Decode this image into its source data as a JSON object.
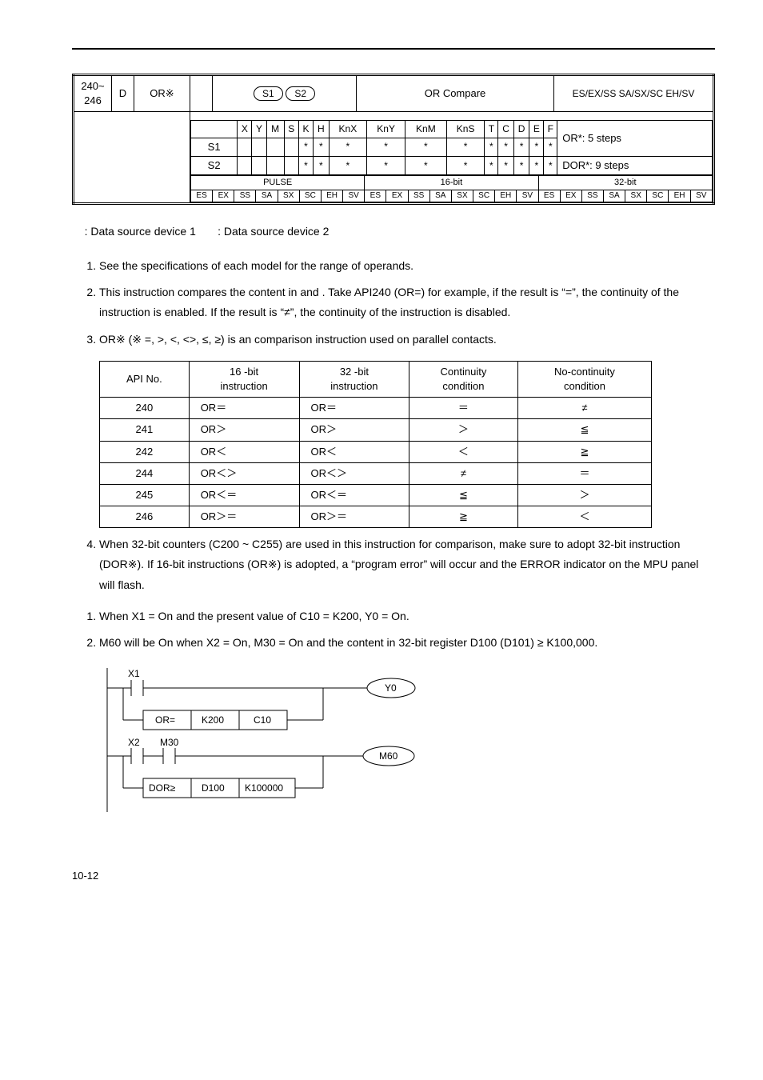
{
  "header": {
    "api_range": "240~\n246",
    "d": "D",
    "mnemonic": "OR※",
    "s1_label": "S1",
    "s2_label": "S2",
    "function": "OR Compare",
    "controllers": "ES/EX/SS SA/SX/SC EH/SV"
  },
  "opgrid": {
    "cols": [
      "X",
      "Y",
      "M",
      "S",
      "K",
      "H",
      "KnX",
      "KnY",
      "KnM",
      "KnS",
      "T",
      "C",
      "D",
      "E",
      "F"
    ],
    "rows": [
      {
        "label": "S1",
        "stars": [
          false,
          false,
          false,
          false,
          true,
          true,
          true,
          true,
          true,
          true,
          true,
          true,
          true,
          true,
          true
        ]
      },
      {
        "label": "S2",
        "stars": [
          false,
          false,
          false,
          false,
          true,
          true,
          true,
          true,
          true,
          true,
          true,
          true,
          true,
          true,
          true
        ]
      }
    ],
    "steps_a": "OR*: 5 steps",
    "steps_b": "DOR*: 9 steps"
  },
  "pulse": {
    "hdr": [
      "PULSE",
      "16-bit",
      "32-bit"
    ],
    "cells": [
      "ES",
      "EX",
      "SS",
      "SA",
      "SX",
      "SC",
      "EH",
      "SV",
      "ES",
      "EX",
      "SS",
      "SA",
      "SX",
      "SC",
      "EH",
      "SV",
      "ES",
      "EX",
      "SS",
      "SA",
      "SX",
      "SC",
      "EH",
      "SV"
    ]
  },
  "desc": {
    "d1": ": Data source device 1",
    "d2": ": Data source device 2"
  },
  "expl": {
    "it1": "See the specifications of each model for the range of operands.",
    "it2a": "This instruction compares the content in ",
    "it2b": " and ",
    "it2c": ". Take API240 (OR=) for example, if the result is “=”, the continuity of the instruction is enabled. If the result is “≠”, the continuity of the instruction is disabled.",
    "it3": "OR※ (※ =, >, <, <>, ≤, ≥) is an comparison instruction used on parallel contacts."
  },
  "api_table": {
    "hdr": [
      "API No.",
      "16 -bit\ninstruction",
      "32 -bit\ninstruction",
      "Continuity\ncondition",
      "No-continuity\ncondition"
    ],
    "rows": [
      [
        "240",
        "OR＝",
        "OR＝",
        "＝",
        "≠"
      ],
      [
        "241",
        "OR＞",
        "OR＞",
        "＞",
        "≦"
      ],
      [
        "242",
        "OR＜",
        "OR＜",
        "＜",
        "≧"
      ],
      [
        "244",
        "OR＜＞",
        "OR＜＞",
        "≠",
        "＝"
      ],
      [
        "245",
        "OR＜＝",
        "OR＜＝",
        "≦",
        "＞"
      ],
      [
        "246",
        "OR＞＝",
        "OR＞＝",
        "≧",
        "＜"
      ]
    ]
  },
  "expl4": "When 32-bit counters (C200 ~ C255) are used in this instruction for comparison, make sure to adopt 32-bit instruction (DOR※). If 16-bit instructions (OR※) is adopted, a “program error” will occur and the ERROR indicator on the MPU panel will flash.",
  "prog": {
    "it1": "When X1 = On and the present value of C10 = K200, Y0 = On.",
    "it2": "M60 will be On when X2 = On, M30 = On and the content in 32-bit register D100 (D101) ≥ K100,000."
  },
  "ladder": {
    "x1": "X1",
    "y0": "Y0",
    "or_eq": "OR=",
    "k200": "K200",
    "c10": "C10",
    "x2": "X2",
    "m30": "M30",
    "m60": "M60",
    "dorge": "DOR≥",
    "d100": "D100",
    "k100000": "K100000"
  },
  "footer": "10-12"
}
